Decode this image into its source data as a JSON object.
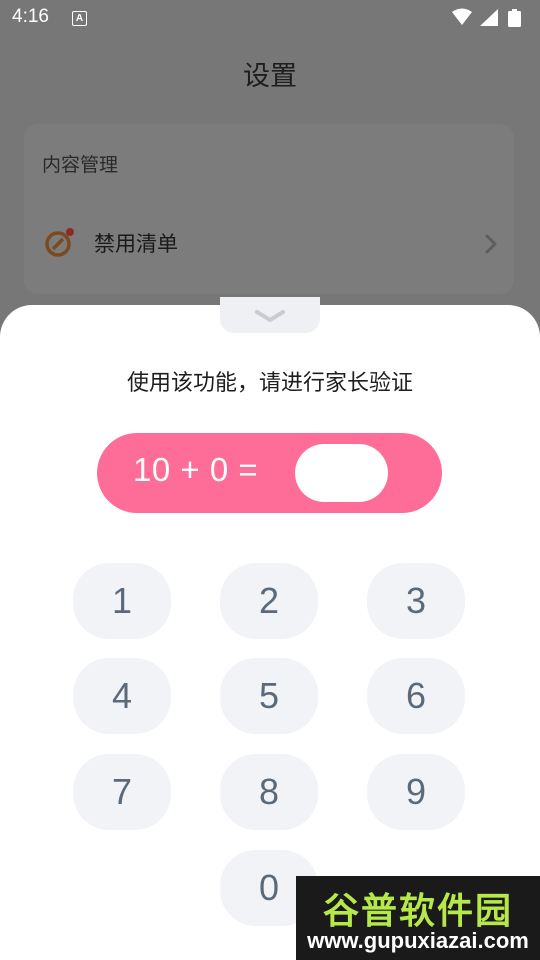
{
  "status_bar": {
    "time": "4:16",
    "notification_glyph": "A"
  },
  "page": {
    "title": "设置",
    "section_label": "内容管理",
    "row_label": "禁用清单"
  },
  "dialog": {
    "prompt": "使用该功能，请进行家长验证",
    "equation": "10 + 0 =",
    "answer": "",
    "keys": [
      "1",
      "2",
      "3",
      "4",
      "5",
      "6",
      "7",
      "8",
      "9",
      "0"
    ]
  },
  "watermark": {
    "title": "谷普软件园",
    "url": "www.gupuxiazai.com"
  },
  "colors": {
    "accent": "#fe6d97",
    "key_bg": "#f1f3f6",
    "key_text": "#5b6a7a"
  }
}
